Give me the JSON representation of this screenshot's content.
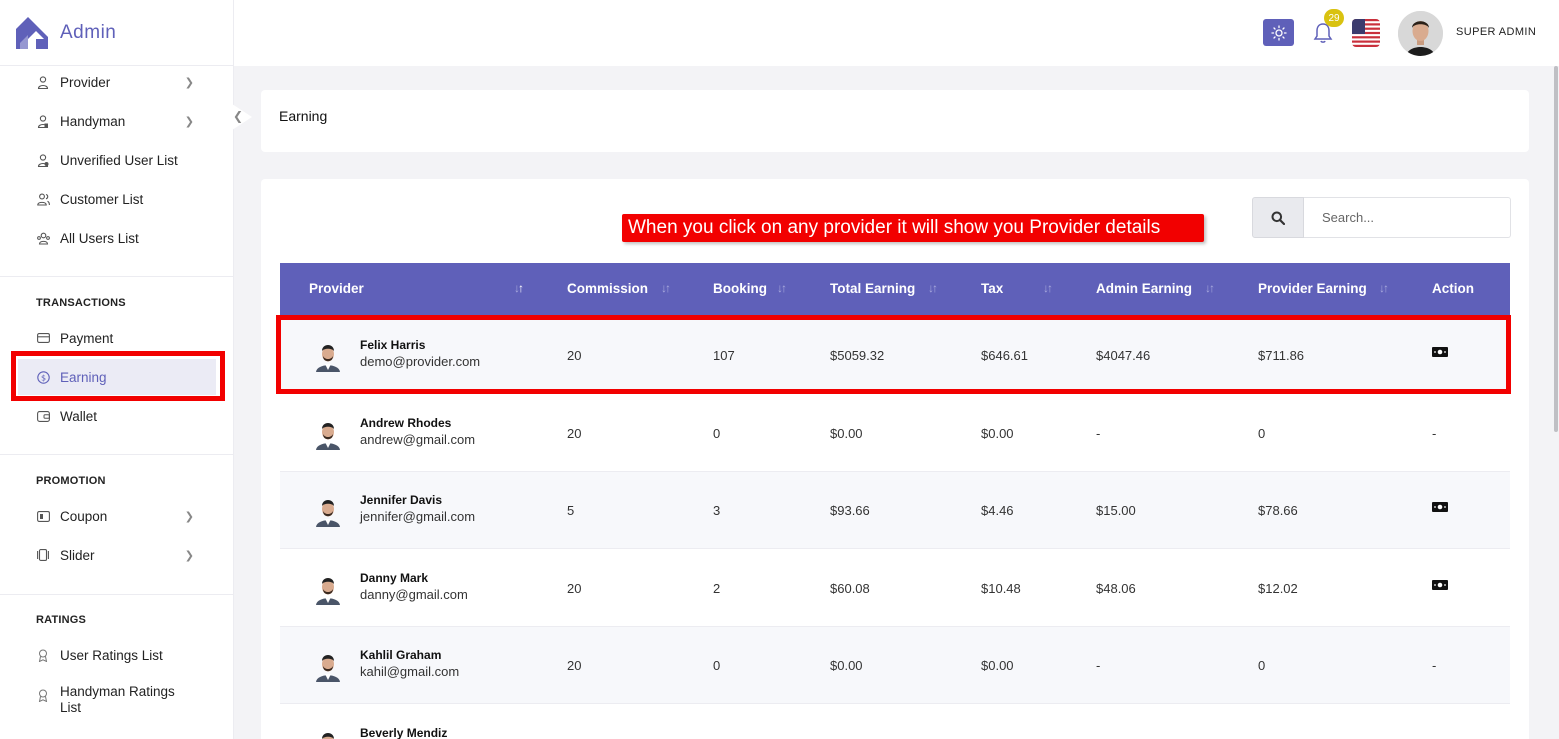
{
  "brand": {
    "name": "Admin"
  },
  "sidebar": {
    "items_top": [
      {
        "label": "Provider",
        "icon": "user-icon",
        "has_chevron": true
      },
      {
        "label": "Handyman",
        "icon": "handyman-icon",
        "has_chevron": true
      },
      {
        "label": "Unverified User List",
        "icon": "user-unverified-icon",
        "has_chevron": false
      },
      {
        "label": "Customer List",
        "icon": "users-icon",
        "has_chevron": false
      },
      {
        "label": "All Users List",
        "icon": "user-group-icon",
        "has_chevron": false
      }
    ],
    "sections": [
      {
        "title": "TRANSACTIONS",
        "items": [
          {
            "label": "Payment",
            "icon": "credit-card-icon"
          },
          {
            "label": "Earning",
            "icon": "dollar-circle-icon",
            "active": true
          },
          {
            "label": "Wallet",
            "icon": "wallet-icon"
          }
        ]
      },
      {
        "title": "PROMOTION",
        "items": [
          {
            "label": "Coupon",
            "icon": "coupon-icon",
            "has_chevron": true
          },
          {
            "label": "Slider",
            "icon": "slider-icon",
            "has_chevron": true
          }
        ]
      },
      {
        "title": "RATINGS",
        "items": [
          {
            "label": "User Ratings List",
            "icon": "rating-icon"
          },
          {
            "label": "Handyman Ratings List",
            "icon": "rating-icon"
          }
        ]
      }
    ]
  },
  "header": {
    "notification_count": "29",
    "user_name": "SUPER ADMIN",
    "theme_icon": "sun-icon",
    "flag_icon": "us-flag-icon"
  },
  "page": {
    "title": "Earning",
    "search_placeholder": "Search...",
    "callout": "When you click on any provider it will show you Provider details"
  },
  "table": {
    "columns": [
      "Provider",
      "Commission",
      "Booking",
      "Total Earning",
      "Tax",
      "Admin Earning",
      "Provider Earning",
      "Action"
    ],
    "rows": [
      {
        "name": "Felix Harris",
        "email": "demo@provider.com",
        "commission": "20",
        "booking": "107",
        "total": "$5059.32",
        "tax": "$646.61",
        "admin": "$4047.46",
        "provider": "$711.86",
        "action": "cash"
      },
      {
        "name": "Andrew Rhodes",
        "email": "andrew@gmail.com",
        "commission": "20",
        "booking": "0",
        "total": "$0.00",
        "tax": "$0.00",
        "admin": "-",
        "provider": "0",
        "action": "-"
      },
      {
        "name": "Jennifer Davis",
        "email": "jennifer@gmail.com",
        "commission": "5",
        "booking": "3",
        "total": "$93.66",
        "tax": "$4.46",
        "admin": "$15.00",
        "provider": "$78.66",
        "action": "cash"
      },
      {
        "name": "Danny Mark",
        "email": "danny@gmail.com",
        "commission": "20",
        "booking": "2",
        "total": "$60.08",
        "tax": "$10.48",
        "admin": "$48.06",
        "provider": "$12.02",
        "action": "cash"
      },
      {
        "name": "Kahlil Graham",
        "email": "kahil@gmail.com",
        "commission": "20",
        "booking": "0",
        "total": "$0.00",
        "tax": "$0.00",
        "admin": "-",
        "provider": "0",
        "action": "-"
      },
      {
        "name": "Beverly Mendiz",
        "email": "",
        "commission": "",
        "booking": "",
        "total": "",
        "tax": "",
        "admin": "",
        "provider": "",
        "action": ""
      }
    ]
  },
  "colors": {
    "primary": "#5f60b9",
    "highlight": "#f20000",
    "badge": "#d9c210"
  }
}
